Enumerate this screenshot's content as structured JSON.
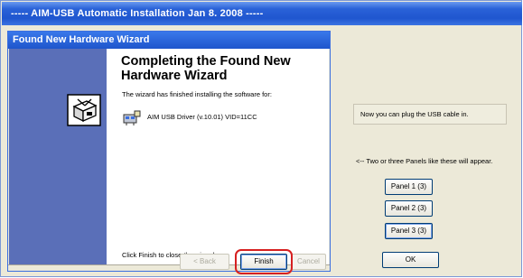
{
  "window": {
    "title": "----- AIM-USB Automatic Installation Jan 8. 2008 -----"
  },
  "wizard": {
    "title": "Found New Hardware Wizard",
    "heading": "Completing the Found New Hardware Wizard",
    "finished_text": "The wizard has finished installing the software for:",
    "driver_name": "AIM USB Driver (v.10.01) VID=11CC",
    "close_text": "Click Finish to close the wizard.",
    "buttons": {
      "back": "< Back",
      "finish": "Finish",
      "cancel": "Cancel"
    },
    "icons": [
      "hardware-box-icon",
      "usb-driver-icon"
    ]
  },
  "side_panel": {
    "notice": "Now you can plug the USB cable in.",
    "info": "<-- Two or three Panels like these will appear.",
    "panels": [
      "Panel 1 (3)",
      "Panel 2 (3)",
      "Panel 3 (3)"
    ],
    "ok_label": "OK"
  },
  "colors": {
    "title_bar": "#2a62d8",
    "dialog_bg": "#ece9d8",
    "wizard_side": "#5a6fb8",
    "highlight": "#d62020"
  }
}
